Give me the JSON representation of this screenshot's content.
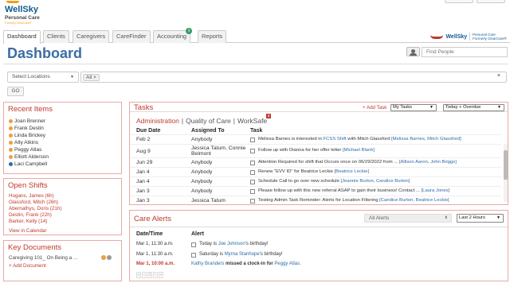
{
  "brand": {
    "name": "WellSky",
    "product": "Personal Care",
    "formerly": "Formerly ClearCare®",
    "right_logo": "WellSky",
    "right_product": "Personal Care",
    "right_formerly": "Formerly ClearCare®"
  },
  "nav": {
    "tabs": [
      {
        "label": "Dashboard",
        "active": true
      },
      {
        "label": "Clients"
      },
      {
        "label": "Caregivers"
      },
      {
        "label": "CareFinder"
      },
      {
        "label": "Accounting",
        "badge": "i"
      },
      {
        "label": "Reports"
      }
    ]
  },
  "page": {
    "title": "Dashboard",
    "find_people_placeholder": "Find People"
  },
  "filters": {
    "locations_placeholder": "Select Locations",
    "chip": "All ×",
    "clear": "×",
    "go_label": "GO"
  },
  "recent_items": {
    "title": "Recent Items",
    "items": [
      {
        "label": "Joan Brenner",
        "kind": "person"
      },
      {
        "label": "Frank Destin",
        "kind": "person"
      },
      {
        "label": "Linda Brickey",
        "kind": "person"
      },
      {
        "label": "Alty Atkins",
        "kind": "person"
      },
      {
        "label": "Peggy Atlas",
        "kind": "person"
      },
      {
        "label": "Elliott Alderson",
        "kind": "person"
      },
      {
        "label": "Laci Campbell",
        "kind": "group"
      }
    ]
  },
  "open_shifts": {
    "title": "Open Shifts",
    "items": [
      "Hogans, James (6h)",
      "Glassford, Mitch (26h)",
      "Abernathys, Doris (21h)",
      "Destin, Frank (22h)",
      "Barker, Kelly (14)"
    ],
    "view_calendar": "View in Calendar"
  },
  "key_documents": {
    "title": "Key Documents",
    "items": [
      "Caregiving 101_ On Being a ..."
    ],
    "add": "+ Add Document"
  },
  "tasks": {
    "title": "Tasks",
    "add_task": "+ Add Task",
    "filter1": "My Tasks",
    "filter2": "Today + Overdue",
    "tab_admin": "Administration",
    "tab_quality": "Quality of Care",
    "tab_worksafe": "WorkSafe",
    "worksafe_badge": "2",
    "separator": "|",
    "col_due": "Due Date",
    "col_assigned": "Assigned To",
    "col_task": "Task",
    "rows": [
      {
        "due": "Feb 2",
        "assigned": "Anybody",
        "text": "Melissa Barnes is interested in ",
        "link1": "FCSS Shift",
        "mid": " with Mitch Glassford ",
        "link2": "[Melissa Barnes, Mitch Glassford]"
      },
      {
        "due": "Aug 9",
        "assigned": "Jessica Tatum, Connie Belmont",
        "text": "Follow up with Dianna for her offer letter ",
        "link1": "[Michael Blank]",
        "mid": "",
        "link2": ""
      },
      {
        "due": "Jun 29",
        "assigned": "Anybody",
        "text": "Attention Required for shift that Occurs once on 06/29/2022 from ... ",
        "link1": "[Allison Aaron, John Briggs]",
        "mid": "",
        "link2": ""
      },
      {
        "due": "Jan 4",
        "assigned": "Anybody",
        "text": "Renew \"EVV ID\" for Beatrice Leckie ",
        "link1": "[Beatrice Leckie]",
        "mid": "",
        "link2": ""
      },
      {
        "due": "Jan 4",
        "assigned": "Anybody",
        "text": "Schedule Call to go over new schedule ",
        "link1": "[Jeannie Burton, Candice Burton]",
        "mid": "",
        "link2": ""
      },
      {
        "due": "Jan 3",
        "assigned": "Anybody",
        "text": "Please follow up with this new referral ASAP to gain their business! Contact ... ",
        "link1": "[Laura Jones]",
        "mid": "",
        "link2": ""
      },
      {
        "due": "Jan 3",
        "assigned": "Jessica Tatum",
        "text": "Testing Admin Task Reminder: Alerts for Location Filtering ",
        "link1": "[Candice Burton, Beatrice Leckie]",
        "mid": "",
        "link2": ""
      }
    ]
  },
  "care_alerts": {
    "title": "Care Alerts",
    "filter1": "All Alerts",
    "filter2": "Last 2 Hours",
    "col_datetime": "Date/Time",
    "col_alert": "Alert",
    "rows": [
      {
        "dt": "Mar 1, 11:30 a.m.",
        "pre": "Today is ",
        "link": "Joe Johnson",
        "post": "'s birthday!",
        "checkbox": true,
        "urgent": false
      },
      {
        "dt": "Mar 1, 11:30 a.m.",
        "pre": "Saturday is ",
        "link": "Myrna Stanhope",
        "post": "'s birthday!",
        "checkbox": true,
        "urgent": false
      },
      {
        "dt": "Mar 1, 10:00 a.m.",
        "pre": "",
        "link": "Kathy Branders",
        "post": " missed a clock-in for ",
        "link2": "Peggy Atlas.",
        "checkbox": false,
        "urgent": true
      }
    ],
    "pager": [
      "«",
      "‹",
      "1",
      "›",
      "»"
    ]
  },
  "colors": {
    "accent_red": "#c0392b",
    "title_blue": "#3b6ea5",
    "link_blue": "#2e6ba8",
    "brand_blue": "#0f5a8f",
    "brand_orange": "#f39c12"
  }
}
